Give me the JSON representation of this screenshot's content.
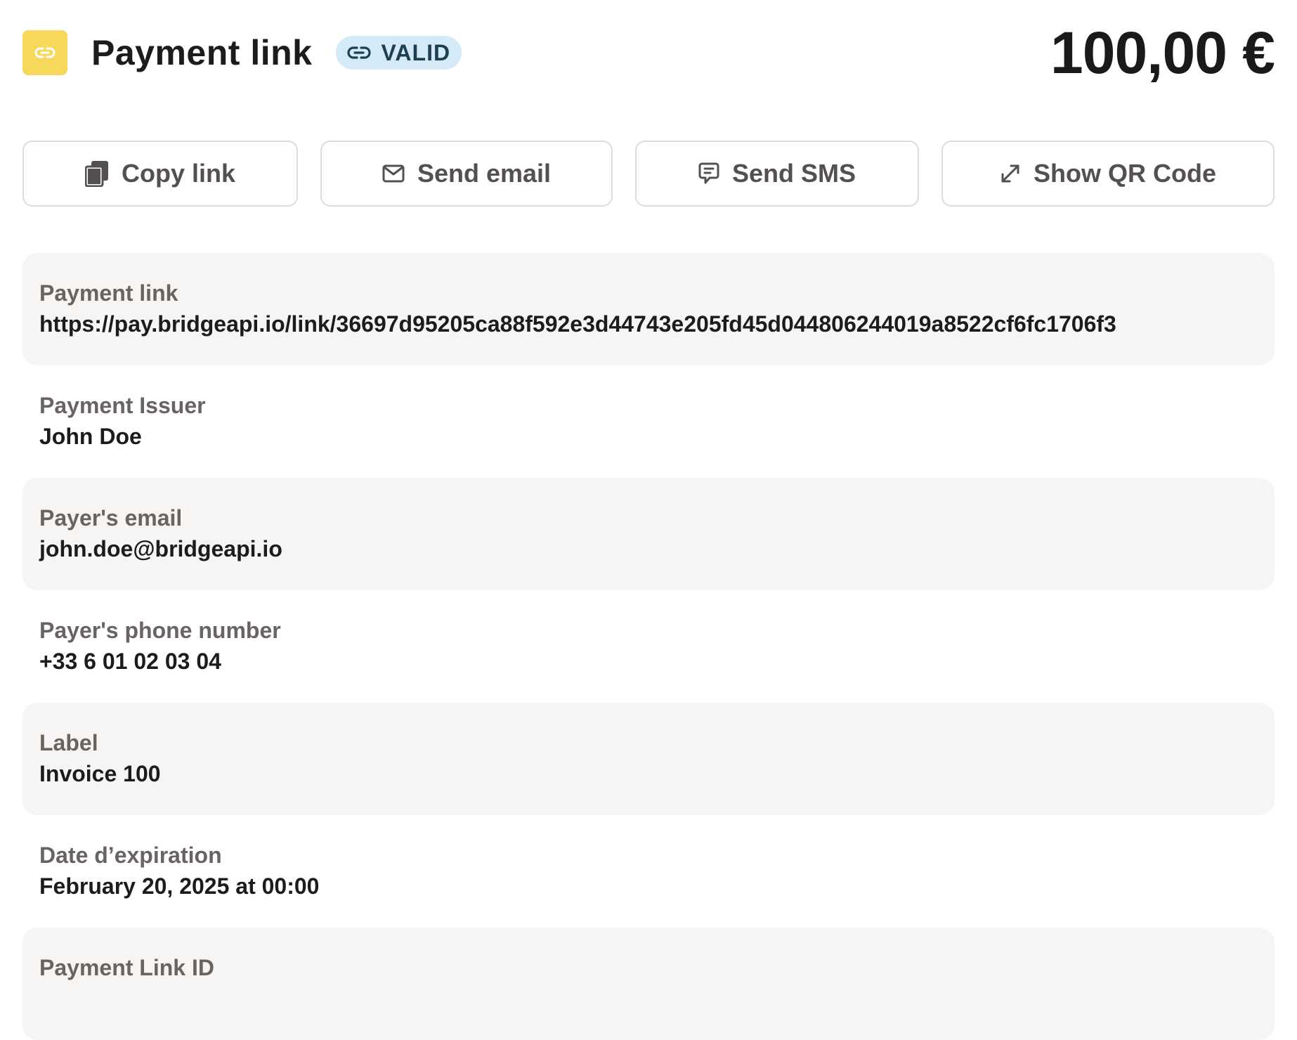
{
  "header": {
    "title": "Payment link",
    "badge": "VALID",
    "amount": "100,00 €"
  },
  "actions": [
    {
      "label": "Copy link",
      "icon": "copy-icon"
    },
    {
      "label": "Send email",
      "icon": "mail-icon"
    },
    {
      "label": "Send SMS",
      "icon": "chat-icon"
    },
    {
      "label": "Show QR Code",
      "icon": "expand-icon"
    }
  ],
  "details": [
    {
      "label": "Payment link",
      "value": "https://pay.bridgeapi.io/link/36697d95205ca88f592e3d44743e205fd45d044806244019a8522cf6fc1706f3"
    },
    {
      "label": "Payment Issuer",
      "value": "John Doe"
    },
    {
      "label": "Payer's email",
      "value": "john.doe@bridgeapi.io"
    },
    {
      "label": "Payer's phone number",
      "value": "+33 6 01 02 03 04"
    },
    {
      "label": "Label",
      "value": "Invoice 100"
    },
    {
      "label": "Date d’expiration",
      "value": "February 20, 2025 at 00:00"
    },
    {
      "label": "Payment Link ID",
      "value": ""
    }
  ],
  "colors": {
    "logo_bg": "#f7d85a",
    "badge_bg": "#d5eaf7",
    "row_shade": "#f6f5f3"
  }
}
